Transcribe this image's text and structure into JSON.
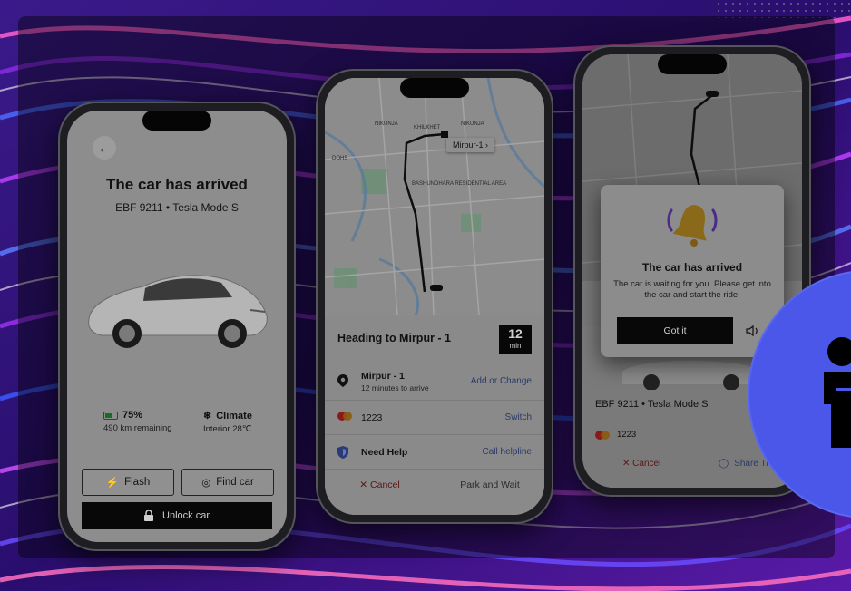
{
  "colors": {
    "accent_blue": "#4a57e8",
    "screen_gray": "#8d8d8d",
    "button_black": "#080808",
    "cancel_red": "#5a1616",
    "link_blue": "#2b3a66"
  },
  "screen1": {
    "back_icon": "arrow-left-icon",
    "title": "The car has arrived",
    "plate_model": "EBF 9211  •  Tesla Mode S",
    "battery_percent": "75%",
    "battery_level": 0.75,
    "range": "490 km remaining",
    "climate_label": "Climate",
    "climate_value": "Interior 28℃",
    "flash_label": "Flash",
    "find_car_label": "Find car",
    "unlock_label": "Unlock car"
  },
  "screen2": {
    "map_pin_label": "Mirpur-1 ›",
    "map_labels": [
      "NIKUNJA",
      "KHILKHET",
      "NIKUNJA",
      "DOHS",
      "BASHUNDHARA RESIDENTIAL AREA"
    ],
    "heading": "Heading to Mirpur - 1",
    "eta_value": "12",
    "eta_unit": "min",
    "destination_name": "Mirpur - 1",
    "destination_sub": "12 minutes to arrive",
    "destination_action": "Add or Change",
    "card_number": "1223",
    "card_action": "Switch",
    "help_label": "Need Help",
    "help_action": "Call helpline",
    "cancel_label": "Cancel",
    "park_label": "Park and Wait"
  },
  "screen3": {
    "modal_title": "The car has arrived",
    "modal_body": "The car is waiting for you. Please get into the car and start the ride.",
    "got_it_label": "Got it",
    "plate_model": "EBF 9211  •  Tesla Mode S",
    "card_number": "1223",
    "cancel_label": "Cancel",
    "share_label": "Share Tr"
  }
}
